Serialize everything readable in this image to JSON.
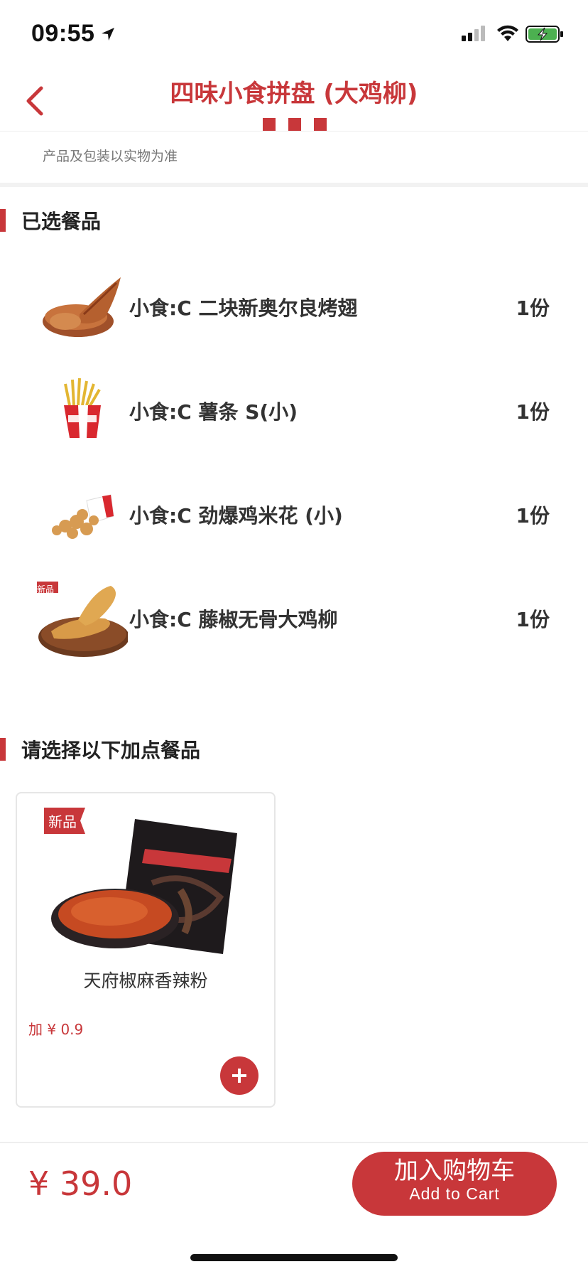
{
  "status_bar": {
    "time": "09:55"
  },
  "header": {
    "title": "四味小食拼盘 (大鸡柳)"
  },
  "notice": "产品及包装以实物为准",
  "selected_section": {
    "title": "已选餐品",
    "items": [
      {
        "name": "小食:C 二块新奥尔良烤翅",
        "qty": "1份",
        "image": "wings-image"
      },
      {
        "name": "小食:C 薯条 S(小)",
        "qty": "1份",
        "image": "fries-image"
      },
      {
        "name": "小食:C 劲爆鸡米花 (小)",
        "qty": "1份",
        "image": "popcorn-chicken-image"
      },
      {
        "name": "小食:C 藤椒无骨大鸡柳",
        "qty": "1份",
        "image": "chicken-strips-image",
        "badge": "新品"
      }
    ]
  },
  "addon_section": {
    "title": "请选择以下加点餐品",
    "items": [
      {
        "badge": "新品",
        "name": "天府椒麻香辣粉",
        "price": "加 ¥ 0.9"
      }
    ]
  },
  "bottom": {
    "total": "¥ 39.0",
    "cart_cn": "加入购物车",
    "cart_en": "Add to Cart"
  },
  "colors": {
    "accent": "#c8373a"
  }
}
